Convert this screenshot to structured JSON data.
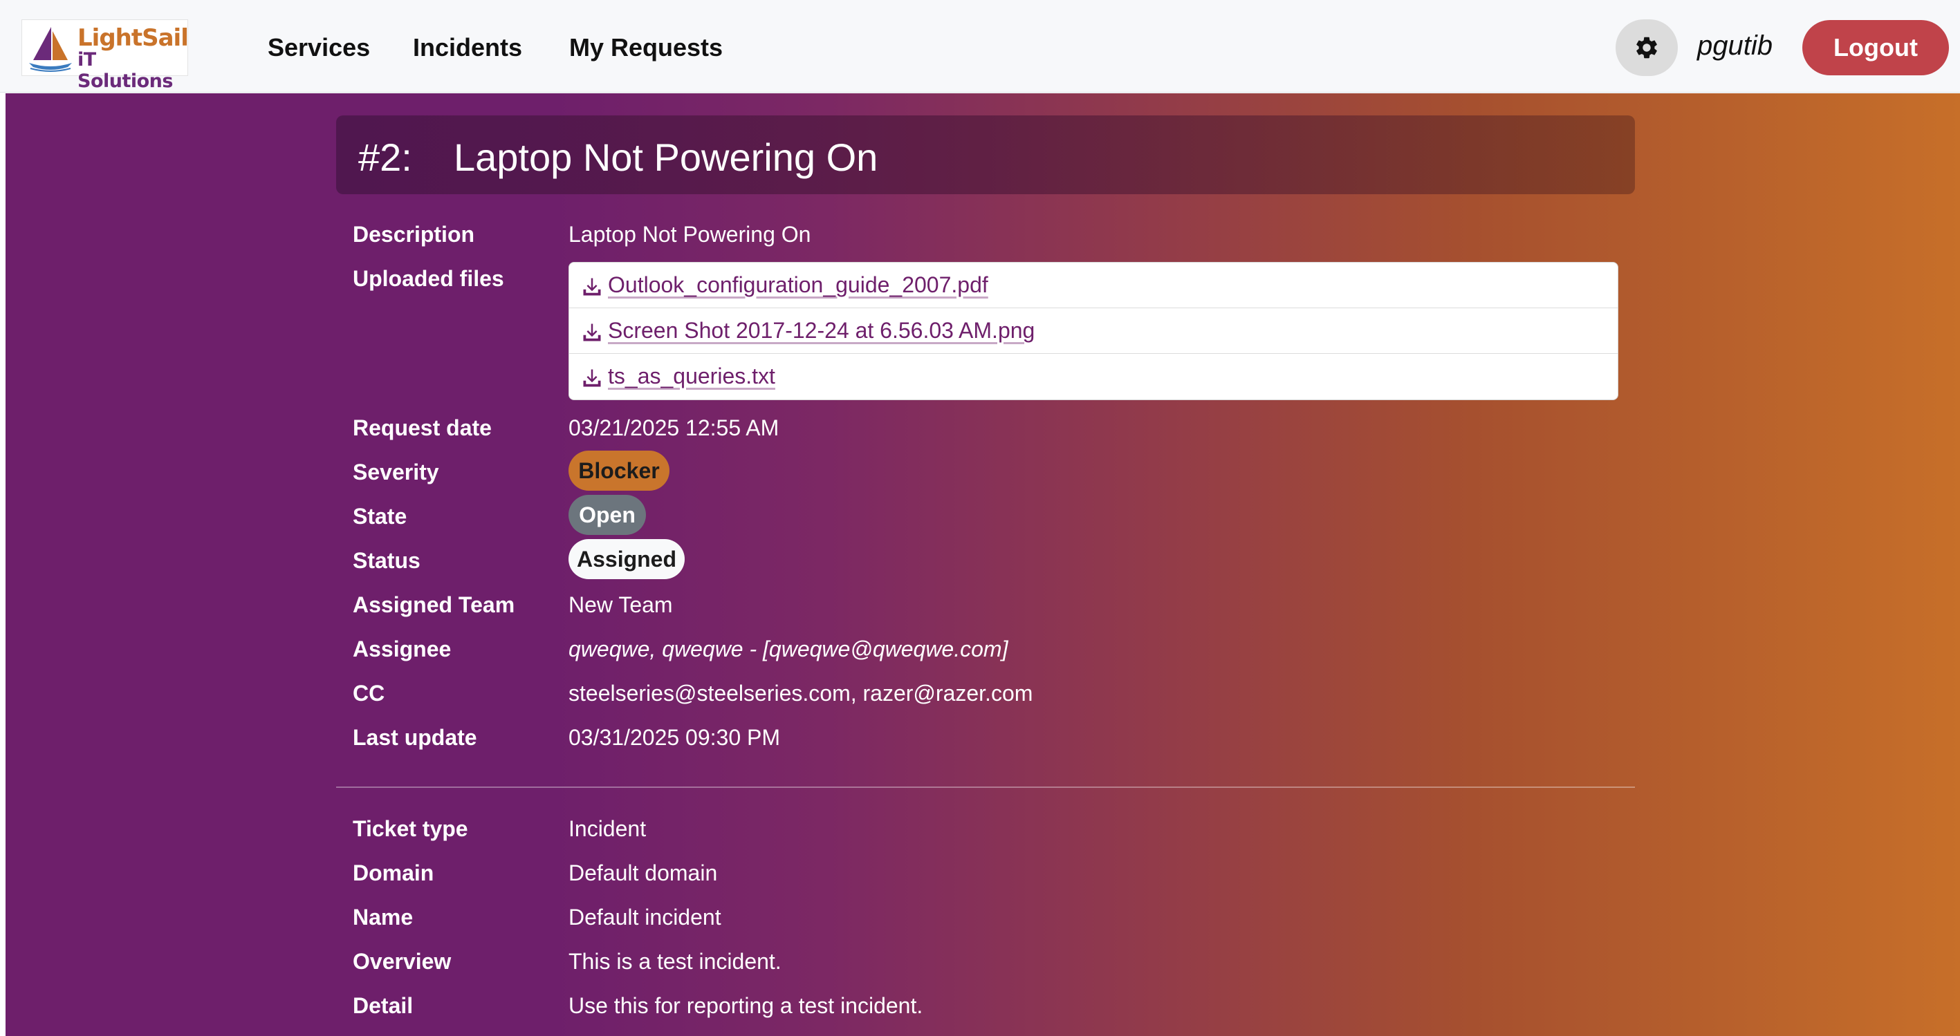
{
  "logo": {
    "line1": "LightSail",
    "line2": "iT Solutions"
  },
  "nav": {
    "services": "Services",
    "incidents": "Incidents",
    "my_requests": "My Requests",
    "username": "pgutib",
    "logout": "Logout"
  },
  "ticket": {
    "number": "#2:",
    "title": "Laptop Not Powering On"
  },
  "labels": {
    "description": "Description",
    "uploaded_files": "Uploaded files",
    "request_date": "Request date",
    "severity": "Severity",
    "state": "State",
    "status": "Status",
    "assigned_team": "Assigned Team",
    "assignee": "Assignee",
    "cc": "CC",
    "last_update": "Last update",
    "ticket_type": "Ticket type",
    "domain": "Domain",
    "name": "Name",
    "overview": "Overview",
    "detail": "Detail"
  },
  "values": {
    "description": "Laptop Not Powering On",
    "files": [
      "Outlook_configuration_guide_2007.pdf",
      "Screen Shot 2017-12-24 at 6.56.03 AM.png",
      "ts_as_queries.txt"
    ],
    "request_date": "03/21/2025 12:55 AM",
    "severity": "Blocker",
    "state": "Open",
    "status": "Assigned",
    "assigned_team": "New Team",
    "assignee": "qweqwe, qweqwe - [qweqwe@qweqwe.com]",
    "cc": "steelseries@steelseries.com, razer@razer.com",
    "last_update": "03/31/2025 09:30 PM",
    "ticket_type": "Incident",
    "domain": "Default domain",
    "name": "Default incident",
    "overview": "This is a test incident.",
    "detail": "Use this for reporting a test incident."
  },
  "colors": {
    "brand_orange": "#c9732a",
    "brand_purple": "#6b2a7a",
    "logout_red": "#c0434a",
    "severity_blocker": "#c9752c",
    "state_open": "#6c757d",
    "status_assigned": "#f8f9fa",
    "gradient_start": "#6e1f6b",
    "gradient_end": "#c76f29"
  },
  "icons": {
    "gear": "gear-icon",
    "download": "download-icon",
    "sailboat": "sailboat-logo-icon"
  }
}
